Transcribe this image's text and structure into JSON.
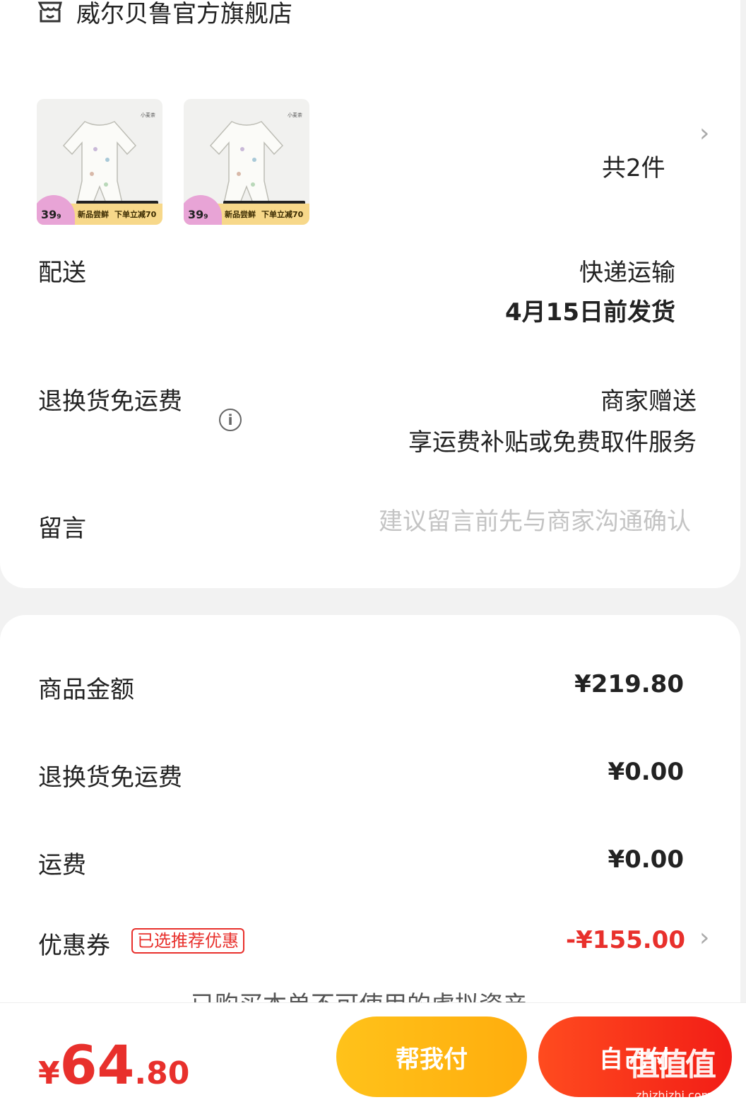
{
  "shop": {
    "name": "威尔贝鲁官方旗舰店",
    "icon": "shop-icon"
  },
  "products": {
    "items": [
      {
        "brand_tag": "小麦茶",
        "price_int": "39",
        "price_dec": "9",
        "promo_a": "新品尝鲜",
        "promo_b": "下单立减70"
      },
      {
        "brand_tag": "小麦茶",
        "price_int": "39",
        "price_dec": "9",
        "promo_a": "新品尝鲜",
        "promo_b": "下单立减70"
      }
    ],
    "count_label": "共2件"
  },
  "delivery": {
    "label": "配送",
    "method": "快递运输",
    "ship_date": "4月15日前发货"
  },
  "return_shipping": {
    "label": "退换货免运费",
    "value": "商家赠送",
    "desc": "享运费补贴或免费取件服务"
  },
  "memo": {
    "label": "留言",
    "placeholder": "建议留言前先与商家沟通确认"
  },
  "summary": {
    "goods_label": "商品金额",
    "goods_value": "¥219.80",
    "return_label": "退换货免运费",
    "return_value": "¥0.00",
    "freight_label": "运费",
    "freight_value": "¥0.00",
    "coupon_label": "优惠券",
    "coupon_badge": "已选推荐优惠",
    "coupon_value": "-¥155.00",
    "cut_text": "已购买本单不可使用的虚拟资产"
  },
  "footer": {
    "currency": "¥",
    "total_int": "64",
    "total_dec": ".80",
    "help_pay": "帮我付",
    "self_pay": "自己付",
    "watermark": "值值值",
    "watermark_url": "zhizhizhi.com"
  },
  "colors": {
    "accent_red": "#e8302c",
    "help_yellow": "#ffc21a"
  }
}
